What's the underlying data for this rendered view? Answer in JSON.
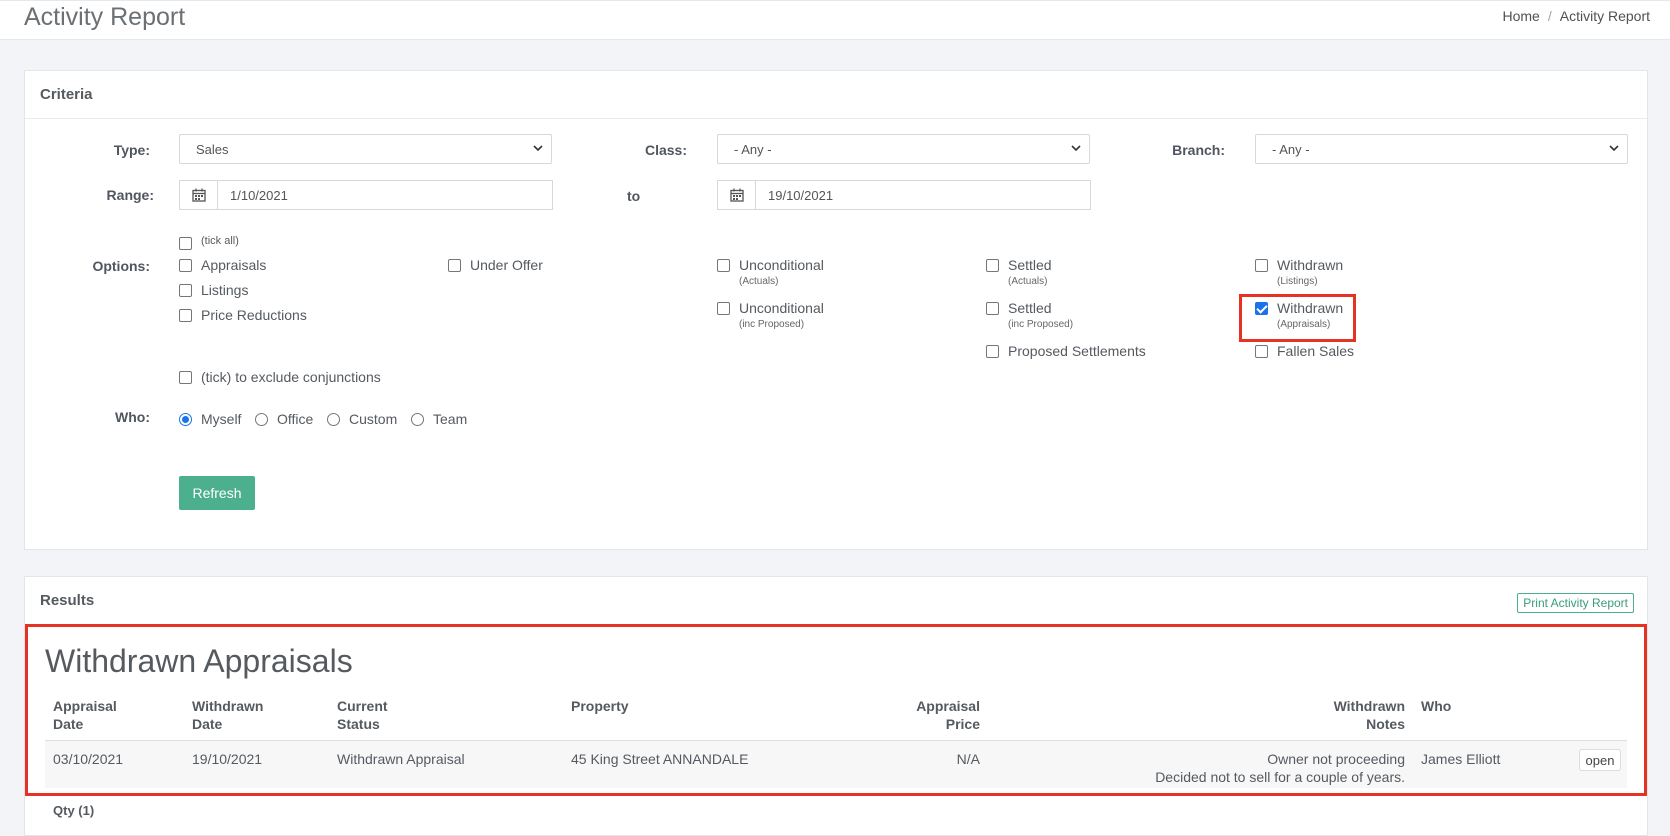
{
  "header": {
    "title": "Activity Report",
    "breadcrumb": [
      "Home",
      "Activity Report"
    ]
  },
  "criteria": {
    "title": "Criteria",
    "type_label": "Type:",
    "type_value": "Sales",
    "class_label": "Class:",
    "class_value": "- Any -",
    "branch_label": "Branch:",
    "branch_value": "- Any -",
    "range_label": "Range:",
    "range_from": "1/10/2021",
    "to_label": "to",
    "range_to": "19/10/2021",
    "options_label": "Options:",
    "tick_all": "(tick all)",
    "appraisals": "Appraisals",
    "listings": "Listings",
    "price_reductions": "Price Reductions",
    "under_offer": "Under Offer",
    "unconditional": "Unconditional",
    "actuals": "(Actuals)",
    "inc_proposed": "(inc Proposed)",
    "settled": "Settled",
    "proposed_settlements": "Proposed Settlements",
    "withdrawn": "Withdrawn",
    "listings_sub": "(Listings)",
    "appraisals_sub": "(Appraisals)",
    "fallen_sales": "Fallen Sales",
    "exclude_conjunctions": "(tick) to exclude conjunctions",
    "who_label": "Who:",
    "who_options": [
      "Myself",
      "Office",
      "Custom",
      "Team"
    ],
    "who_selected": "Myself",
    "withdrawn_appraisals_checked": true,
    "refresh": "Refresh"
  },
  "results": {
    "title": "Results",
    "print": "Print Activity Report",
    "section_title": "Withdrawn Appraisals",
    "columns": {
      "appraisal_date": [
        "Appraisal",
        "Date"
      ],
      "withdrawn_date": [
        "Withdrawn",
        "Date"
      ],
      "current_status": [
        "Current",
        "Status"
      ],
      "property": "Property",
      "appraisal_price": [
        "Appraisal",
        "Price"
      ],
      "withdrawn_notes": [
        "Withdrawn",
        "Notes"
      ],
      "who": "Who"
    },
    "rows": [
      {
        "appraisal_date": "03/10/2021",
        "withdrawn_date": "19/10/2021",
        "current_status": "Withdrawn Appraisal",
        "property": "45 King Street ANNANDALE",
        "appraisal_price": "N/A",
        "notes_line1": "Owner not proceeding",
        "notes_line2": "Decided not to sell for a couple of years.",
        "who": "James Elliott",
        "action": "open"
      }
    ],
    "qty": "Qty (1)"
  }
}
